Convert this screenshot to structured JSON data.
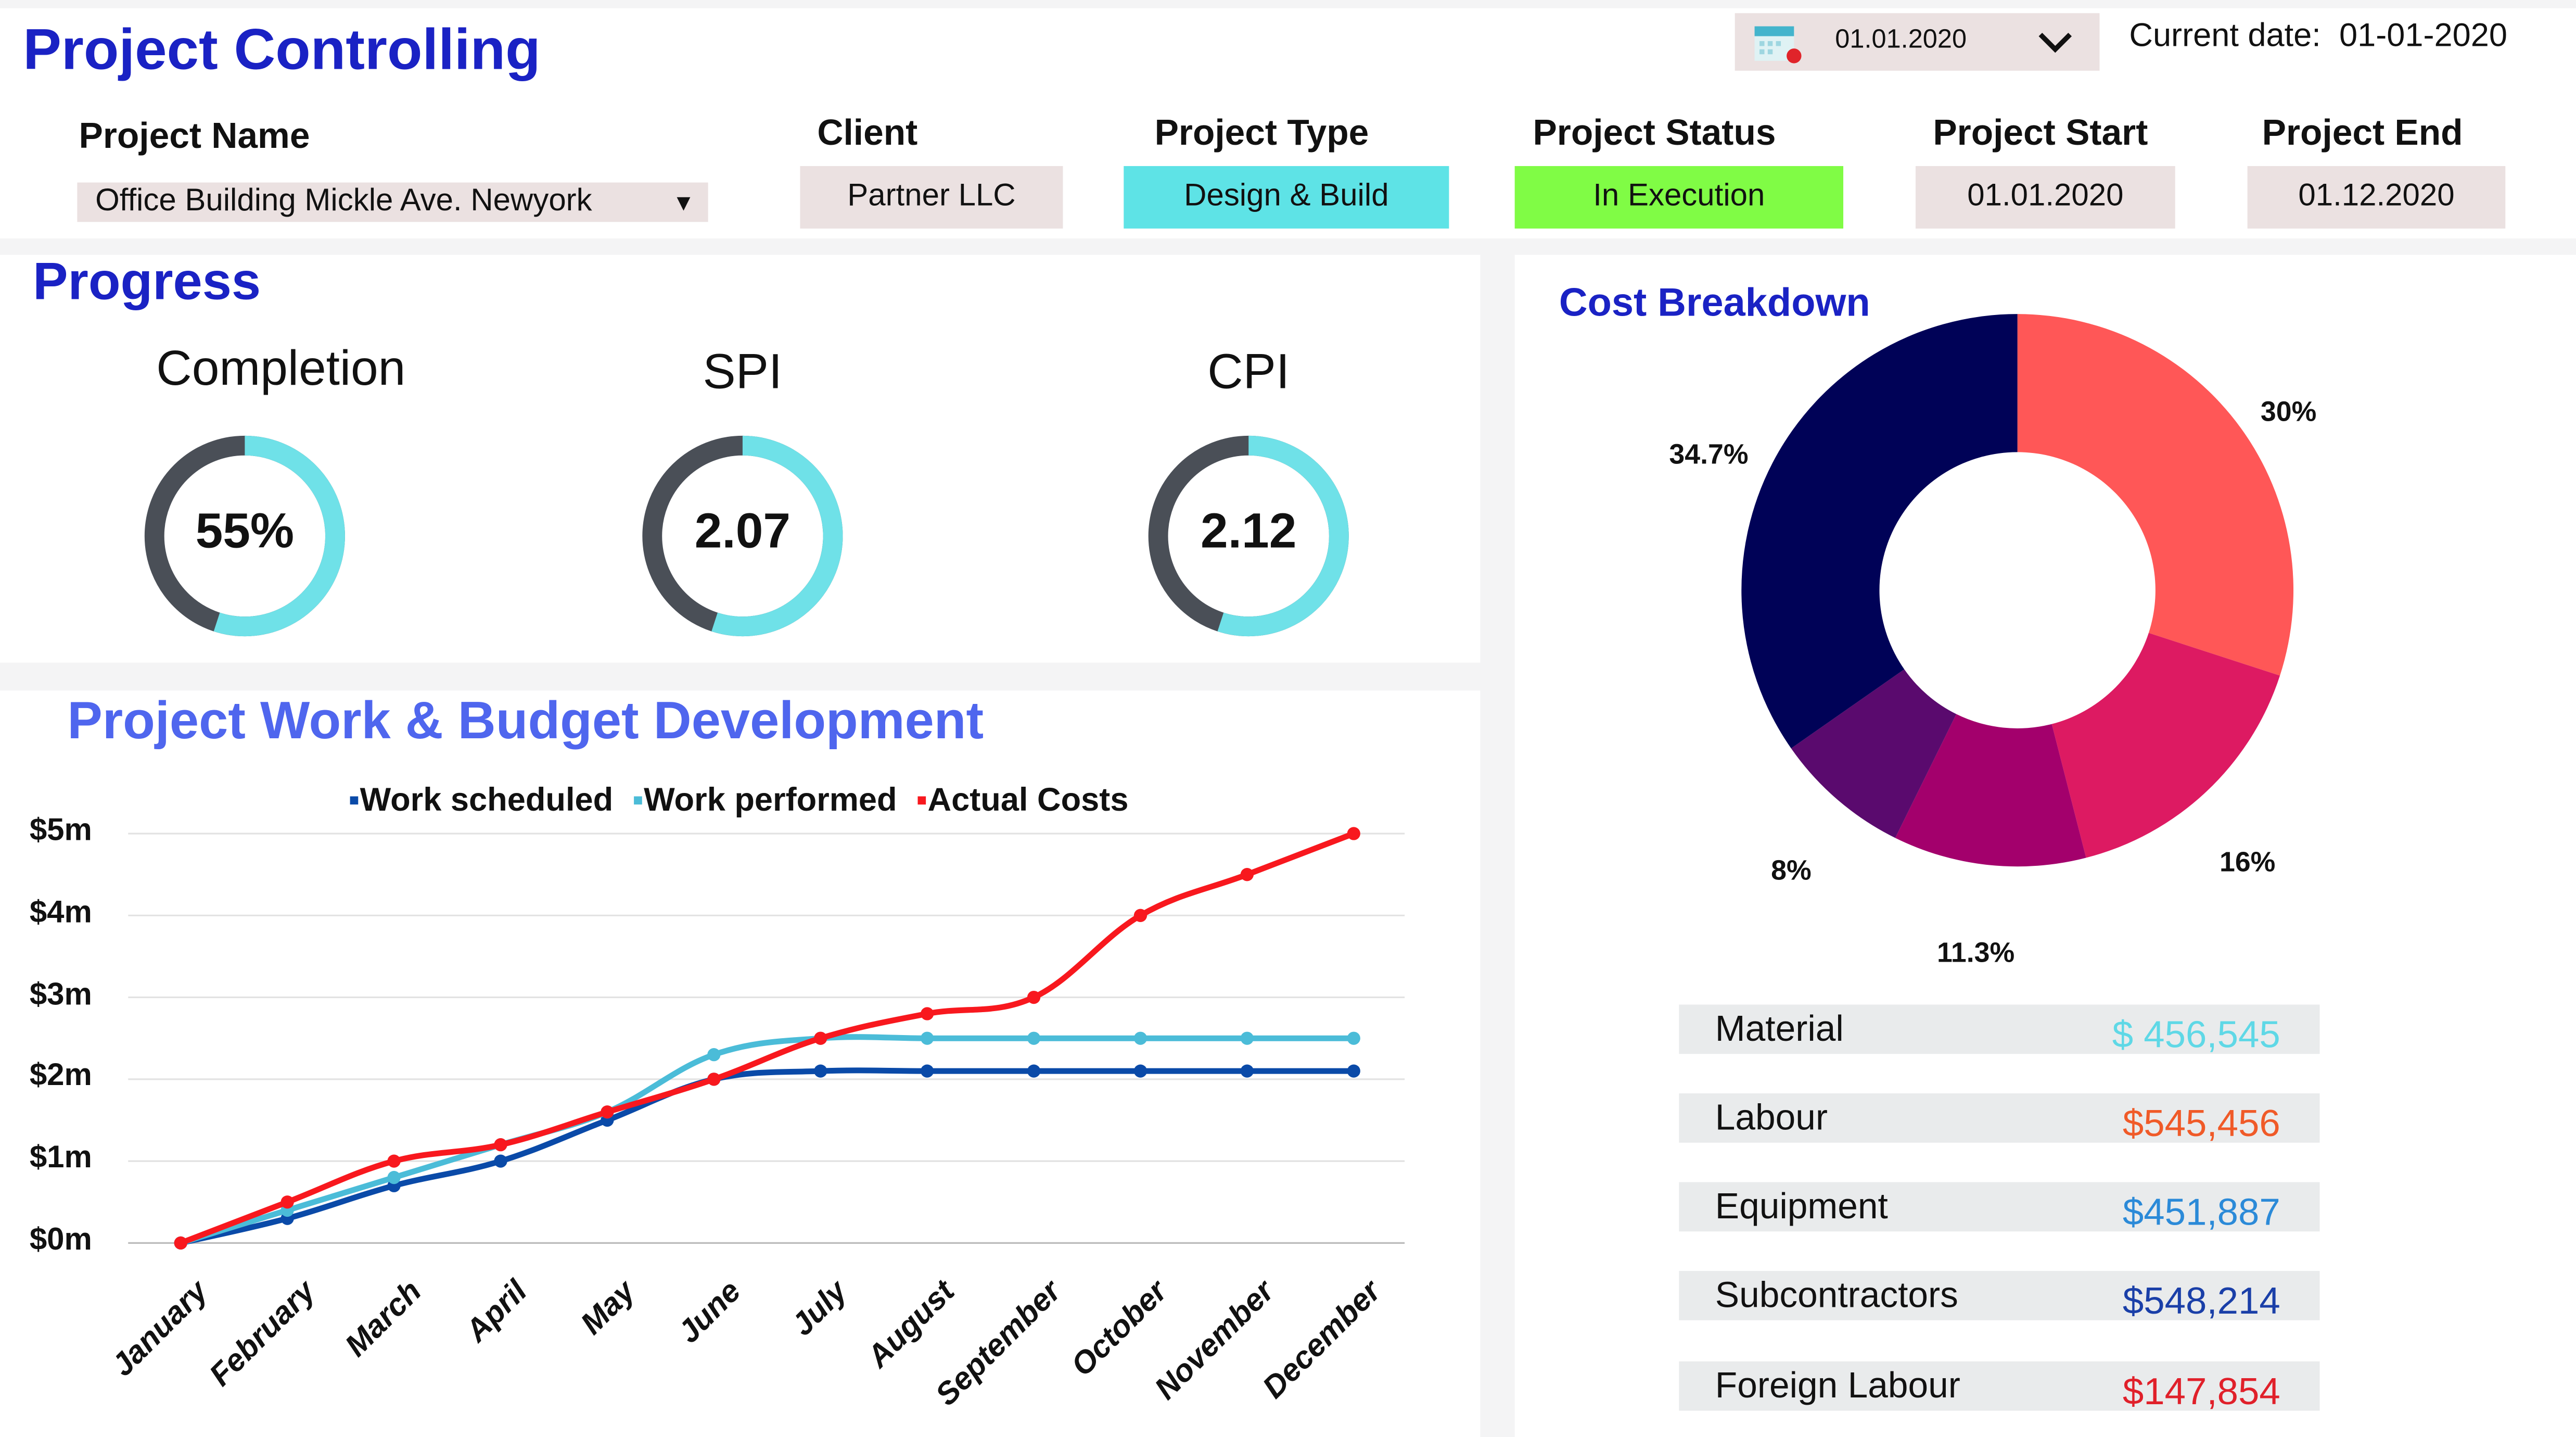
{
  "header": {
    "title": "Project Controlling",
    "date_picker": {
      "value": "01.01.2020",
      "icon": "calendar-icon"
    },
    "current_date_label": "Current date:",
    "current_date": "01-01-2020"
  },
  "project": {
    "name": {
      "label": "Project Name",
      "value": "Office Building Mickle Ave. Newyork"
    },
    "client": {
      "label": "Client",
      "value": "Partner LLC"
    },
    "type": {
      "label": "Project Type",
      "value": "Design & Build",
      "color": "#5ee3e6"
    },
    "status": {
      "label": "Project Status",
      "value": "In Execution",
      "color": "#80fc45"
    },
    "start": {
      "label": "Project Start",
      "value": "01.01.2020"
    },
    "end": {
      "label": "Project End",
      "value": "01.12.2020"
    }
  },
  "progress": {
    "title": "Progress",
    "gauges": [
      {
        "label": "Completion",
        "value": "55%",
        "fill": 0.55
      },
      {
        "label": "SPI",
        "value": "2.07",
        "fill": 0.55
      },
      {
        "label": "CPI",
        "value": "2.12",
        "fill": 0.55
      }
    ],
    "colors": {
      "track": "#4a4f57",
      "fill": "#6fe1e8"
    }
  },
  "chart_data": [
    {
      "type": "line",
      "title": "Project Work & Budget Development",
      "categories": [
        "January",
        "February",
        "March",
        "April",
        "May",
        "June",
        "July",
        "August",
        "September",
        "October",
        "November",
        "December"
      ],
      "yticks": [
        "$0m",
        "$1m",
        "$2m",
        "$3m",
        "$4m",
        "$5m"
      ],
      "ylim": [
        0,
        5
      ],
      "grid": true,
      "legend": "top",
      "series": [
        {
          "name": "Work scheduled",
          "color": "#0a4aa8",
          "values": [
            0,
            0.3,
            0.7,
            1.0,
            1.5,
            2.0,
            2.1,
            2.1,
            2.1,
            2.1,
            2.1,
            2.1
          ]
        },
        {
          "name": "Work performed",
          "color": "#4bbcd8",
          "values": [
            0,
            0.4,
            0.8,
            1.2,
            1.6,
            2.3,
            2.5,
            2.5,
            2.5,
            2.5,
            2.5,
            2.5
          ]
        },
        {
          "name": "Actual Costs",
          "color": "#f8181e",
          "values": [
            0,
            0.5,
            1.0,
            1.2,
            1.6,
            2.0,
            2.5,
            2.8,
            3.0,
            4.0,
            4.5,
            5.0
          ]
        }
      ]
    },
    {
      "type": "pie",
      "title": "Cost Breakdown",
      "slices": [
        {
          "label": "30%",
          "value": 30,
          "color": "#ff5757"
        },
        {
          "label": "16%",
          "value": 16,
          "color": "#dd1a62"
        },
        {
          "label": "11.3%",
          "value": 11.3,
          "color": "#a3006c"
        },
        {
          "label": "8%",
          "value": 8,
          "color": "#5a0a6e"
        },
        {
          "label": "34.7%",
          "value": 34.7,
          "color": "#000257"
        }
      ]
    }
  ],
  "costs": [
    {
      "name": "Material",
      "value": "$ 456,545",
      "color": "#5fd8e6"
    },
    {
      "name": "Labour",
      "value": "$545,456",
      "color": "#f05a28"
    },
    {
      "name": "Equipment",
      "value": "$451,887",
      "color": "#2b8ad8"
    },
    {
      "name": "Subcontractors",
      "value": "$548,214",
      "color": "#1a3fa8"
    },
    {
      "name": "Foreign Labour",
      "value": "$147,854",
      "color": "#e0202a"
    }
  ]
}
